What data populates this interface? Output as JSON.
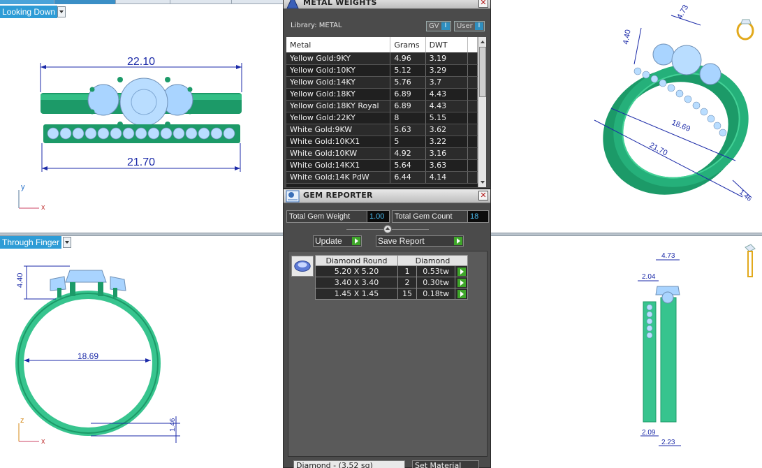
{
  "viewports": {
    "top_left": {
      "label": "Looking Down",
      "dim_top": "22.10",
      "dim_bottom": "21.70",
      "axis_v": "y",
      "axis_h": "x"
    },
    "bottom_left": {
      "label": "Through Finger",
      "dim_height": "4.40",
      "dim_diameter": "18.69",
      "dim_band": "1.46",
      "axis_v": "z",
      "axis_h": "x"
    },
    "top_right": {
      "dim_height": "4.40",
      "dim_diameter": "18.69",
      "dim_width": "21.70",
      "dim_top": "4.73",
      "dim_band": "1.46"
    },
    "bottom_right": {
      "dim_top": "4.73",
      "dim_left": "2.04",
      "dim_bottom_left": "2.09",
      "dim_bottom_right": "2.23"
    }
  },
  "metal_panel": {
    "title": "METAL WEIGHTS",
    "library_label": "Library: METAL",
    "gv_label": "GV",
    "user_label": "User",
    "toggle_mark": "I",
    "columns": [
      "Metal",
      "Grams",
      "DWT"
    ],
    "rows": [
      {
        "metal": "Yellow Gold:9KY",
        "grams": "4.96",
        "dwt": "3.19"
      },
      {
        "metal": "Yellow Gold:10KY",
        "grams": "5.12",
        "dwt": "3.29"
      },
      {
        "metal": "Yellow Gold:14KY",
        "grams": "5.76",
        "dwt": "3.7"
      },
      {
        "metal": "Yellow Gold:18KY",
        "grams": "6.89",
        "dwt": "4.43"
      },
      {
        "metal": "Yellow Gold:18KY Royal",
        "grams": "6.89",
        "dwt": "4.43"
      },
      {
        "metal": "Yellow Gold:22KY",
        "grams": "8",
        "dwt": "5.15"
      },
      {
        "metal": "White Gold:9KW",
        "grams": "5.63",
        "dwt": "3.62"
      },
      {
        "metal": "White Gold:10KX1",
        "grams": "5",
        "dwt": "3.22"
      },
      {
        "metal": "White Gold:10KW",
        "grams": "4.92",
        "dwt": "3.16"
      },
      {
        "metal": "White Gold:14KX1",
        "grams": "5.64",
        "dwt": "3.63"
      },
      {
        "metal": "White Gold:14K PdW",
        "grams": "6.44",
        "dwt": "4.14"
      }
    ]
  },
  "gem_panel": {
    "title": "GEM REPORTER",
    "total_weight_label": "Total Gem Weight",
    "total_weight_value": "1.00",
    "total_count_label": "Total Gem Count",
    "total_count_value": "18",
    "update_label": "Update",
    "save_report_label": "Save Report",
    "table_headers": [
      "Diamond Round",
      "Diamond"
    ],
    "rows": [
      {
        "size": "5.20 X 5.20",
        "count": "1",
        "weight": "0.53tw"
      },
      {
        "size": "3.40 X 3.40",
        "count": "2",
        "weight": "0.30tw"
      },
      {
        "size": "1.45 X 1.45",
        "count": "15",
        "weight": "0.18tw"
      }
    ],
    "bottom_select": "Diamond - (3.52 sg)",
    "set_material_label": "Set Material"
  },
  "colors": {
    "metal": "#1f9e6e",
    "metal_light": "#37c48e",
    "gem": "#a9d4ff",
    "dimension": "#1b2aa8",
    "viewport_label": "#2e9cd6"
  }
}
